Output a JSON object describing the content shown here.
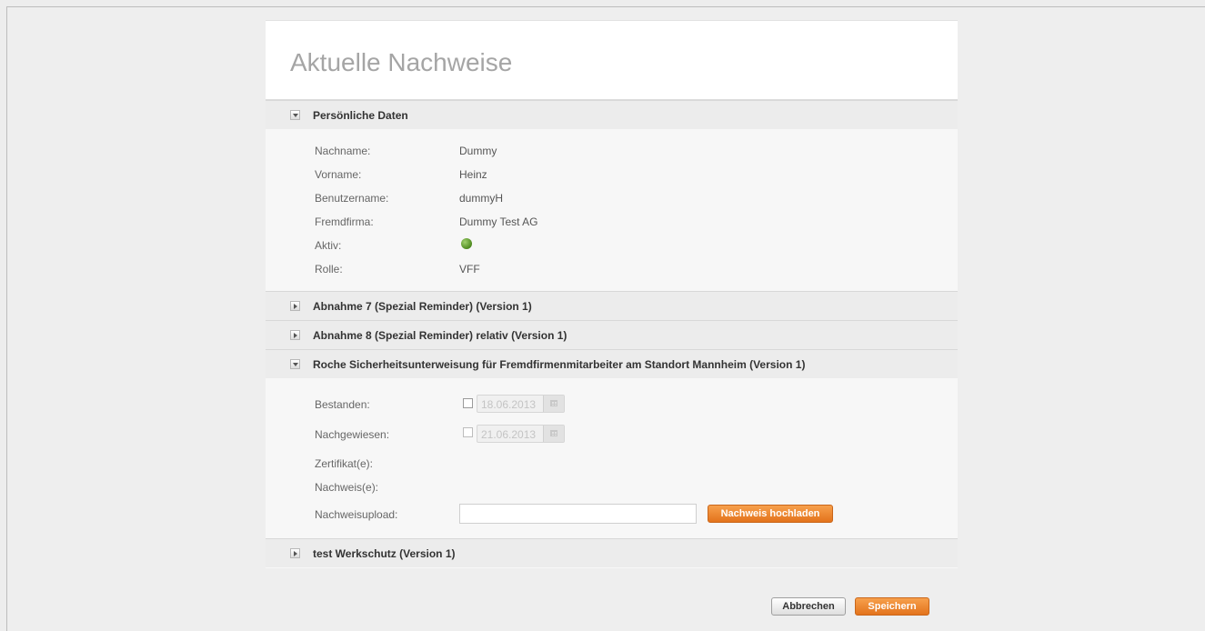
{
  "page": {
    "title": "Aktuelle Nachweise"
  },
  "personal": {
    "header": "Persönliche Daten",
    "fields": [
      {
        "label": "Nachname:",
        "value": "Dummy"
      },
      {
        "label": "Vorname:",
        "value": "Heinz"
      },
      {
        "label": "Benutzername:",
        "value": "dummyH"
      },
      {
        "label": "Fremdfirma:",
        "value": "Dummy Test AG"
      },
      {
        "label": "Aktiv:",
        "value": ""
      },
      {
        "label": "Rolle:",
        "value": "VFF"
      }
    ],
    "active_icon": "green-status-dot"
  },
  "sections": {
    "abnahme7": "Abnahme 7 (Spezial Reminder) (Version 1)",
    "abnahme8": "Abnahme 8 (Spezial Reminder) relativ (Version 1)",
    "roche": "Roche Sicherheitsunterweisung für Fremdfirmenmitarbeiter am Standort Mannheim (Version 1)",
    "werkschutz": "test Werkschutz (Version 1)"
  },
  "roche": {
    "bestanden_label": "Bestanden:",
    "bestanden_date": "18.06.2013",
    "nachgewiesen_label": "Nachgewiesen:",
    "nachgewiesen_date": "21.06.2013",
    "zertifikat_label": "Zertifikat(e):",
    "nachweis_label": "Nachweis(e):",
    "upload_label": "Nachweisupload:",
    "upload_value": "",
    "upload_button": "Nachweis hochladen"
  },
  "footer": {
    "cancel_label": "Abbrechen",
    "save_label": "Speichern"
  },
  "colors": {
    "accent": "#e87a22",
    "active": "#5a9a26"
  }
}
